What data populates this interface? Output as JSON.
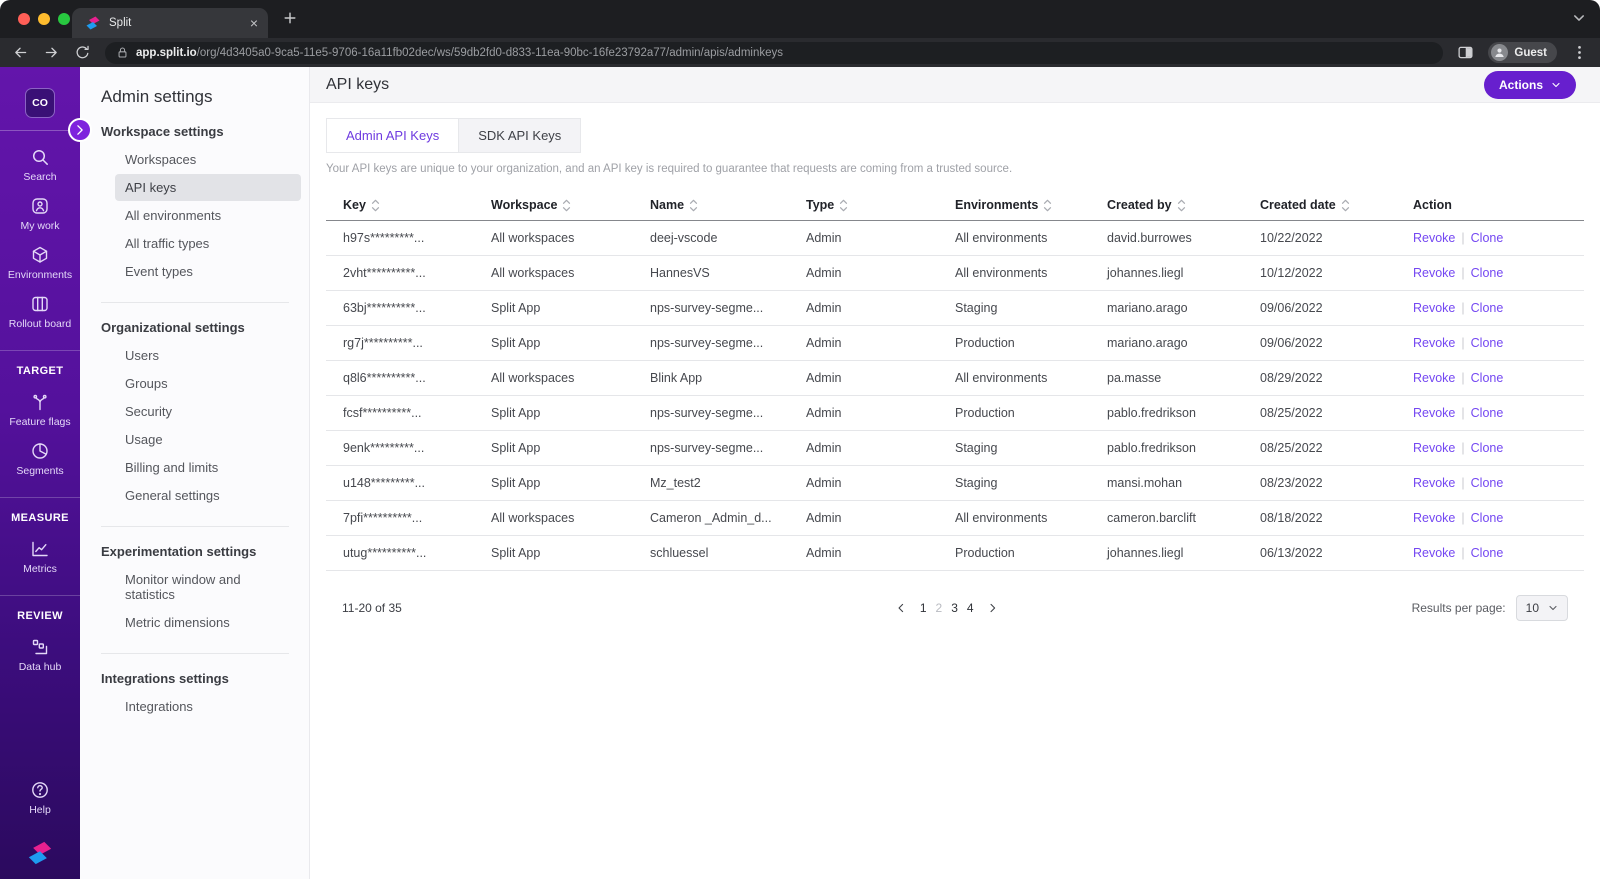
{
  "browser": {
    "tab_title": "Split",
    "url_host": "app.split.io",
    "url_path": "/org/4d3405a0-9ca5-11e5-9706-16a11fb02dec/ws/59db2fd0-d833-11ea-90bc-16fe23792a77/admin/apis/adminkeys",
    "guest_label": "Guest"
  },
  "sidebar": {
    "org_badge": "CO",
    "groups": [
      {
        "header": "",
        "items": [
          {
            "icon": "search-icon",
            "label": "Search"
          },
          {
            "icon": "my-work-icon",
            "label": "My work"
          },
          {
            "icon": "environments-icon",
            "label": "Environments"
          },
          {
            "icon": "rollout-board-icon",
            "label": "Rollout board"
          }
        ]
      },
      {
        "header": "TARGET",
        "items": [
          {
            "icon": "feature-flags-icon",
            "label": "Feature flags"
          },
          {
            "icon": "segments-icon",
            "label": "Segments"
          }
        ]
      },
      {
        "header": "MEASURE",
        "items": [
          {
            "icon": "metrics-icon",
            "label": "Metrics"
          }
        ]
      },
      {
        "header": "REVIEW",
        "items": [
          {
            "icon": "data-hub-icon",
            "label": "Data hub"
          }
        ]
      }
    ],
    "footer_items": [
      {
        "icon": "help-icon",
        "label": "Help"
      }
    ]
  },
  "admin_nav": {
    "title": "Admin settings",
    "sections": [
      {
        "header": "Workspace settings",
        "items": [
          {
            "label": "Workspaces",
            "active": false
          },
          {
            "label": "API keys",
            "active": true
          },
          {
            "label": "All environments",
            "active": false
          },
          {
            "label": "All traffic types",
            "active": false
          },
          {
            "label": "Event types",
            "active": false
          }
        ]
      },
      {
        "header": "Organizational settings",
        "items": [
          {
            "label": "Users",
            "active": false
          },
          {
            "label": "Groups",
            "active": false
          },
          {
            "label": "Security",
            "active": false
          },
          {
            "label": "Usage",
            "active": false
          },
          {
            "label": "Billing and limits",
            "active": false
          },
          {
            "label": "General settings",
            "active": false
          }
        ]
      },
      {
        "header": "Experimentation settings",
        "items": [
          {
            "label": "Monitor window and statistics",
            "active": false
          },
          {
            "label": "Metric dimensions",
            "active": false
          }
        ]
      },
      {
        "header": "Integrations settings",
        "items": [
          {
            "label": "Integrations",
            "active": false
          }
        ]
      }
    ]
  },
  "main": {
    "title": "API keys",
    "actions_button": "Actions",
    "tabs": [
      {
        "label": "Admin API Keys",
        "active": true
      },
      {
        "label": "SDK API Keys",
        "active": false
      }
    ],
    "description": "Your API keys are unique to your organization, and an API key is required to guarantee that requests are coming from a trusted source.",
    "table": {
      "columns": [
        {
          "label": "Key",
          "sortable": true
        },
        {
          "label": "Workspace",
          "sortable": true
        },
        {
          "label": "Name",
          "sortable": true
        },
        {
          "label": "Type",
          "sortable": true
        },
        {
          "label": "Environments",
          "sortable": true
        },
        {
          "label": "Created by",
          "sortable": true
        },
        {
          "label": "Created date",
          "sortable": true
        },
        {
          "label": "Action",
          "sortable": false
        }
      ],
      "rows": [
        {
          "key": "h97s*********...",
          "workspace": "All workspaces",
          "name": "deej-vscode",
          "type": "Admin",
          "environments": "All environments",
          "created_by": "david.burrowes",
          "created_date": "10/22/2022",
          "actions": [
            "Revoke",
            "Clone"
          ]
        },
        {
          "key": "2vht**********...",
          "workspace": "All workspaces",
          "name": "HannesVS",
          "type": "Admin",
          "environments": "All environments",
          "created_by": "johannes.liegl",
          "created_date": "10/12/2022",
          "actions": [
            "Revoke",
            "Clone"
          ]
        },
        {
          "key": "63bj**********...",
          "workspace": "Split App",
          "name": "nps-survey-segme...",
          "type": "Admin",
          "environments": "Staging",
          "created_by": "mariano.arago",
          "created_date": "09/06/2022",
          "actions": [
            "Revoke",
            "Clone"
          ]
        },
        {
          "key": "rg7j**********...",
          "workspace": "Split App",
          "name": "nps-survey-segme...",
          "type": "Admin",
          "environments": "Production",
          "created_by": "mariano.arago",
          "created_date": "09/06/2022",
          "actions": [
            "Revoke",
            "Clone"
          ]
        },
        {
          "key": "q8l6**********...",
          "workspace": "All workspaces",
          "name": "Blink App",
          "type": "Admin",
          "environments": "All environments",
          "created_by": "pa.masse",
          "created_date": "08/29/2022",
          "actions": [
            "Revoke",
            "Clone"
          ]
        },
        {
          "key": "fcsf**********...",
          "workspace": "Split App",
          "name": "nps-survey-segme...",
          "type": "Admin",
          "environments": "Production",
          "created_by": "pablo.fredrikson",
          "created_date": "08/25/2022",
          "actions": [
            "Revoke",
            "Clone"
          ]
        },
        {
          "key": "9enk*********...",
          "workspace": "Split App",
          "name": "nps-survey-segme...",
          "type": "Admin",
          "environments": "Staging",
          "created_by": "pablo.fredrikson",
          "created_date": "08/25/2022",
          "actions": [
            "Revoke",
            "Clone"
          ]
        },
        {
          "key": "u148*********...",
          "workspace": "Split App",
          "name": "Mz_test2",
          "type": "Admin",
          "environments": "Staging",
          "created_by": "mansi.mohan",
          "created_date": "08/23/2022",
          "actions": [
            "Revoke",
            "Clone"
          ]
        },
        {
          "key": "7pfi**********...",
          "workspace": "All workspaces",
          "name": "Cameron _Admin_d...",
          "type": "Admin",
          "environments": "All environments",
          "created_by": "cameron.barclift",
          "created_date": "08/18/2022",
          "actions": [
            "Revoke",
            "Clone"
          ]
        },
        {
          "key": "utug**********...",
          "workspace": "Split App",
          "name": "schluessel",
          "type": "Admin",
          "environments": "Production",
          "created_by": "johannes.liegl",
          "created_date": "06/13/2022",
          "actions": [
            "Revoke",
            "Clone"
          ]
        }
      ]
    },
    "pagination": {
      "range_label": "11-20 of 35",
      "pages": [
        "1",
        "2",
        "3",
        "4"
      ],
      "current_page": "2",
      "results_per_page_label": "Results per page:",
      "results_per_page": "10"
    }
  },
  "colors": {
    "accent_purple": "#671fce",
    "link_purple": "#7447f2",
    "sidebar_gradient_top": "#6315ab",
    "sidebar_gradient_bottom": "#2b0a5e",
    "active_tab_text": "#6f3be0"
  }
}
